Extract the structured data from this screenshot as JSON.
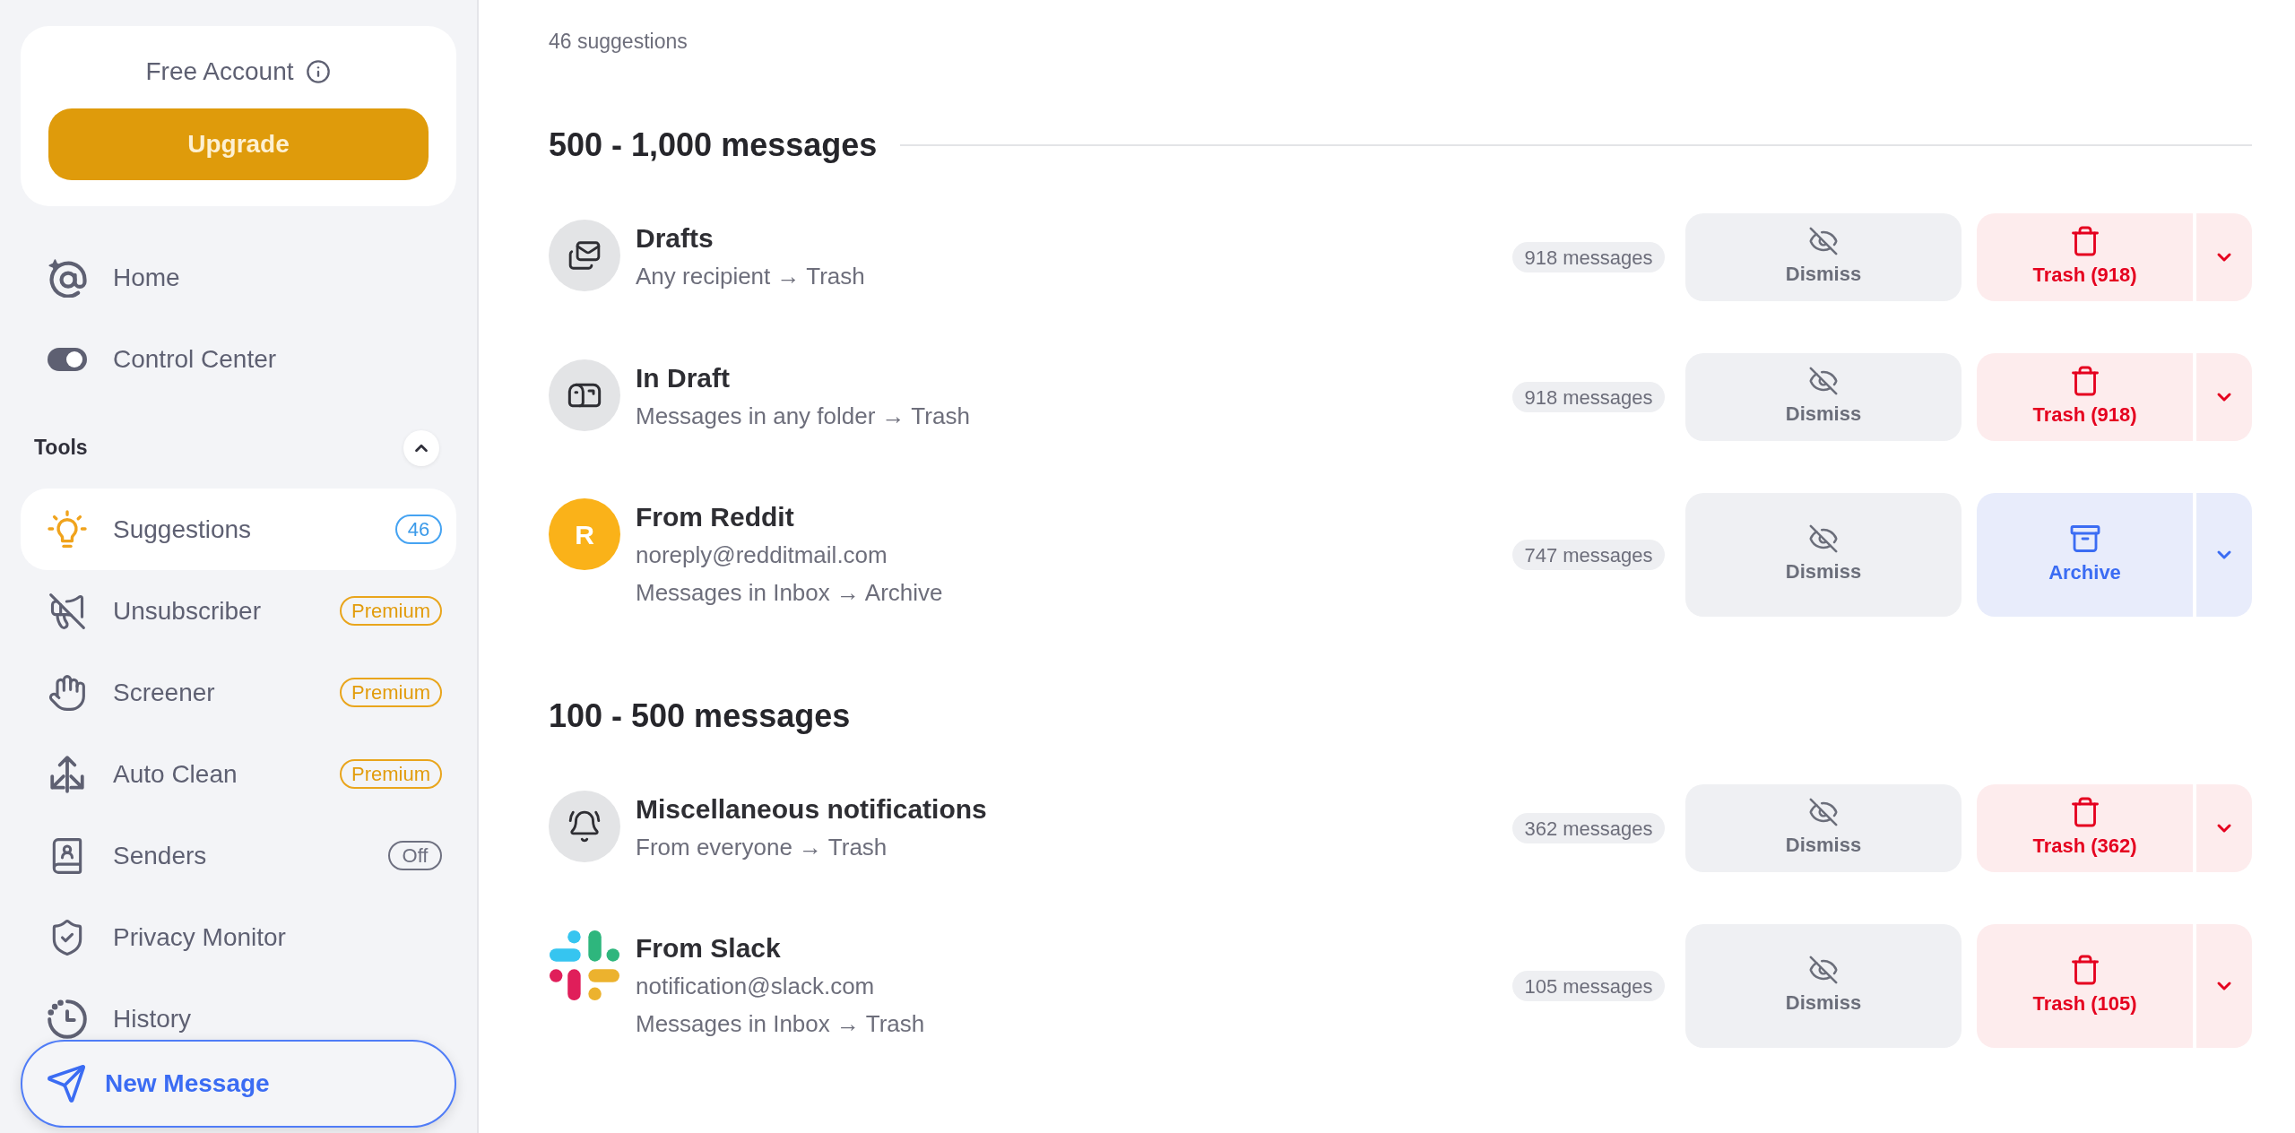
{
  "sidebar": {
    "account": {
      "label": "Free Account",
      "button": "Upgrade"
    },
    "items": [
      {
        "label": "Home",
        "selected": false
      },
      {
        "label": "Control Center",
        "selected": false
      }
    ],
    "tools": {
      "title": "Tools",
      "expanded": true,
      "items": [
        {
          "label": "Suggestions",
          "selected": true,
          "badge": {
            "kind": "count",
            "text": "46"
          }
        },
        {
          "label": "Unsubscriber",
          "selected": false,
          "badge": {
            "kind": "premium",
            "text": "Premium"
          }
        },
        {
          "label": "Screener",
          "selected": false,
          "badge": {
            "kind": "premium",
            "text": "Premium"
          }
        },
        {
          "label": "Auto Clean",
          "selected": false,
          "badge": {
            "kind": "premium",
            "text": "Premium"
          }
        },
        {
          "label": "Senders",
          "selected": false,
          "badge": {
            "kind": "off",
            "text": "Off"
          }
        },
        {
          "label": "Privacy Monitor",
          "selected": false
        },
        {
          "label": "History",
          "selected": false
        }
      ]
    },
    "new_message": "New Message"
  },
  "main": {
    "count": "46 suggestions",
    "sections": [
      {
        "title": "500 - 1,000 messages",
        "divider": true,
        "rows": [
          {
            "avatar": {
              "kind": "envelopes"
            },
            "title": "Drafts",
            "lines": [
              "Any recipient → Trash"
            ],
            "count": "918 messages",
            "dismiss": "Dismiss",
            "action": {
              "kind": "trash",
              "label": "Trash (918)"
            }
          },
          {
            "avatar": {
              "kind": "mailbox"
            },
            "title": "In Draft",
            "lines": [
              "Messages in any folder → Trash"
            ],
            "count": "918 messages",
            "dismiss": "Dismiss",
            "action": {
              "kind": "trash",
              "label": "Trash (918)"
            }
          },
          {
            "avatar": {
              "kind": "letter",
              "initial": "R"
            },
            "title": "From Reddit",
            "lines": [
              "noreply@redditmail.com",
              "Messages in Inbox → Archive"
            ],
            "count": "747 messages",
            "dismiss": "Dismiss",
            "action": {
              "kind": "archive",
              "label": "Archive"
            }
          }
        ]
      },
      {
        "title": "100 - 500 messages",
        "divider": false,
        "rows": [
          {
            "avatar": {
              "kind": "bell"
            },
            "title": "Miscellaneous notifications",
            "lines": [
              "From everyone → Trash"
            ],
            "count": "362 messages",
            "dismiss": "Dismiss",
            "action": {
              "kind": "trash",
              "label": "Trash (362)"
            }
          },
          {
            "avatar": {
              "kind": "logo"
            },
            "title": "From Slack",
            "lines": [
              "notification@slack.com",
              "Messages in Inbox → Trash"
            ],
            "count": "105 messages",
            "dismiss": "Dismiss",
            "action": {
              "kind": "trash",
              "label": "Trash (105)"
            }
          }
        ]
      }
    ]
  }
}
